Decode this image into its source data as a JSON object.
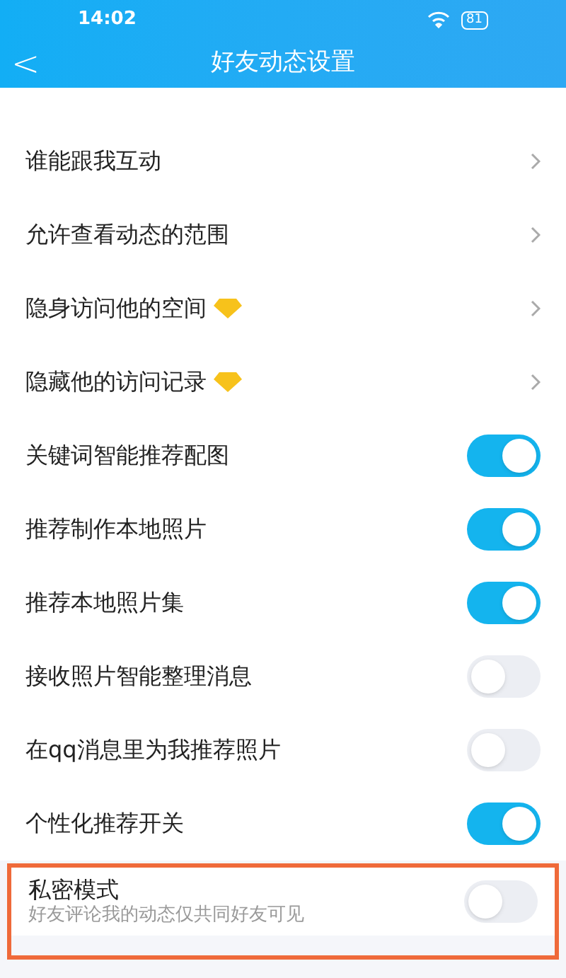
{
  "status_bar": {
    "time": "14:02",
    "battery": "81"
  },
  "header": {
    "back": "<",
    "title": "好友动态设置"
  },
  "settings": [
    {
      "kind": "link",
      "label": "谁能跟我互动",
      "vip": false
    },
    {
      "kind": "link",
      "label": "允许查看动态的范围",
      "vip": false
    },
    {
      "kind": "link",
      "label": "隐身访问他的空间",
      "vip": true
    },
    {
      "kind": "link",
      "label": "隐藏他的访问记录",
      "vip": true
    },
    {
      "kind": "toggle",
      "label": "关键词智能推荐配图",
      "on": true
    },
    {
      "kind": "toggle",
      "label": "推荐制作本地照片",
      "on": true
    },
    {
      "kind": "toggle",
      "label": "推荐本地照片集",
      "on": true
    },
    {
      "kind": "toggle",
      "label": "接收照片智能整理消息",
      "on": false
    },
    {
      "kind": "toggle",
      "label": "在qq消息里为我推荐照片",
      "on": false
    },
    {
      "kind": "toggle",
      "label": "个性化推荐开关",
      "on": true
    }
  ],
  "private_mode": {
    "label": "私密模式",
    "description": "好友评论我的动态仅共同好友可见",
    "on": false
  }
}
